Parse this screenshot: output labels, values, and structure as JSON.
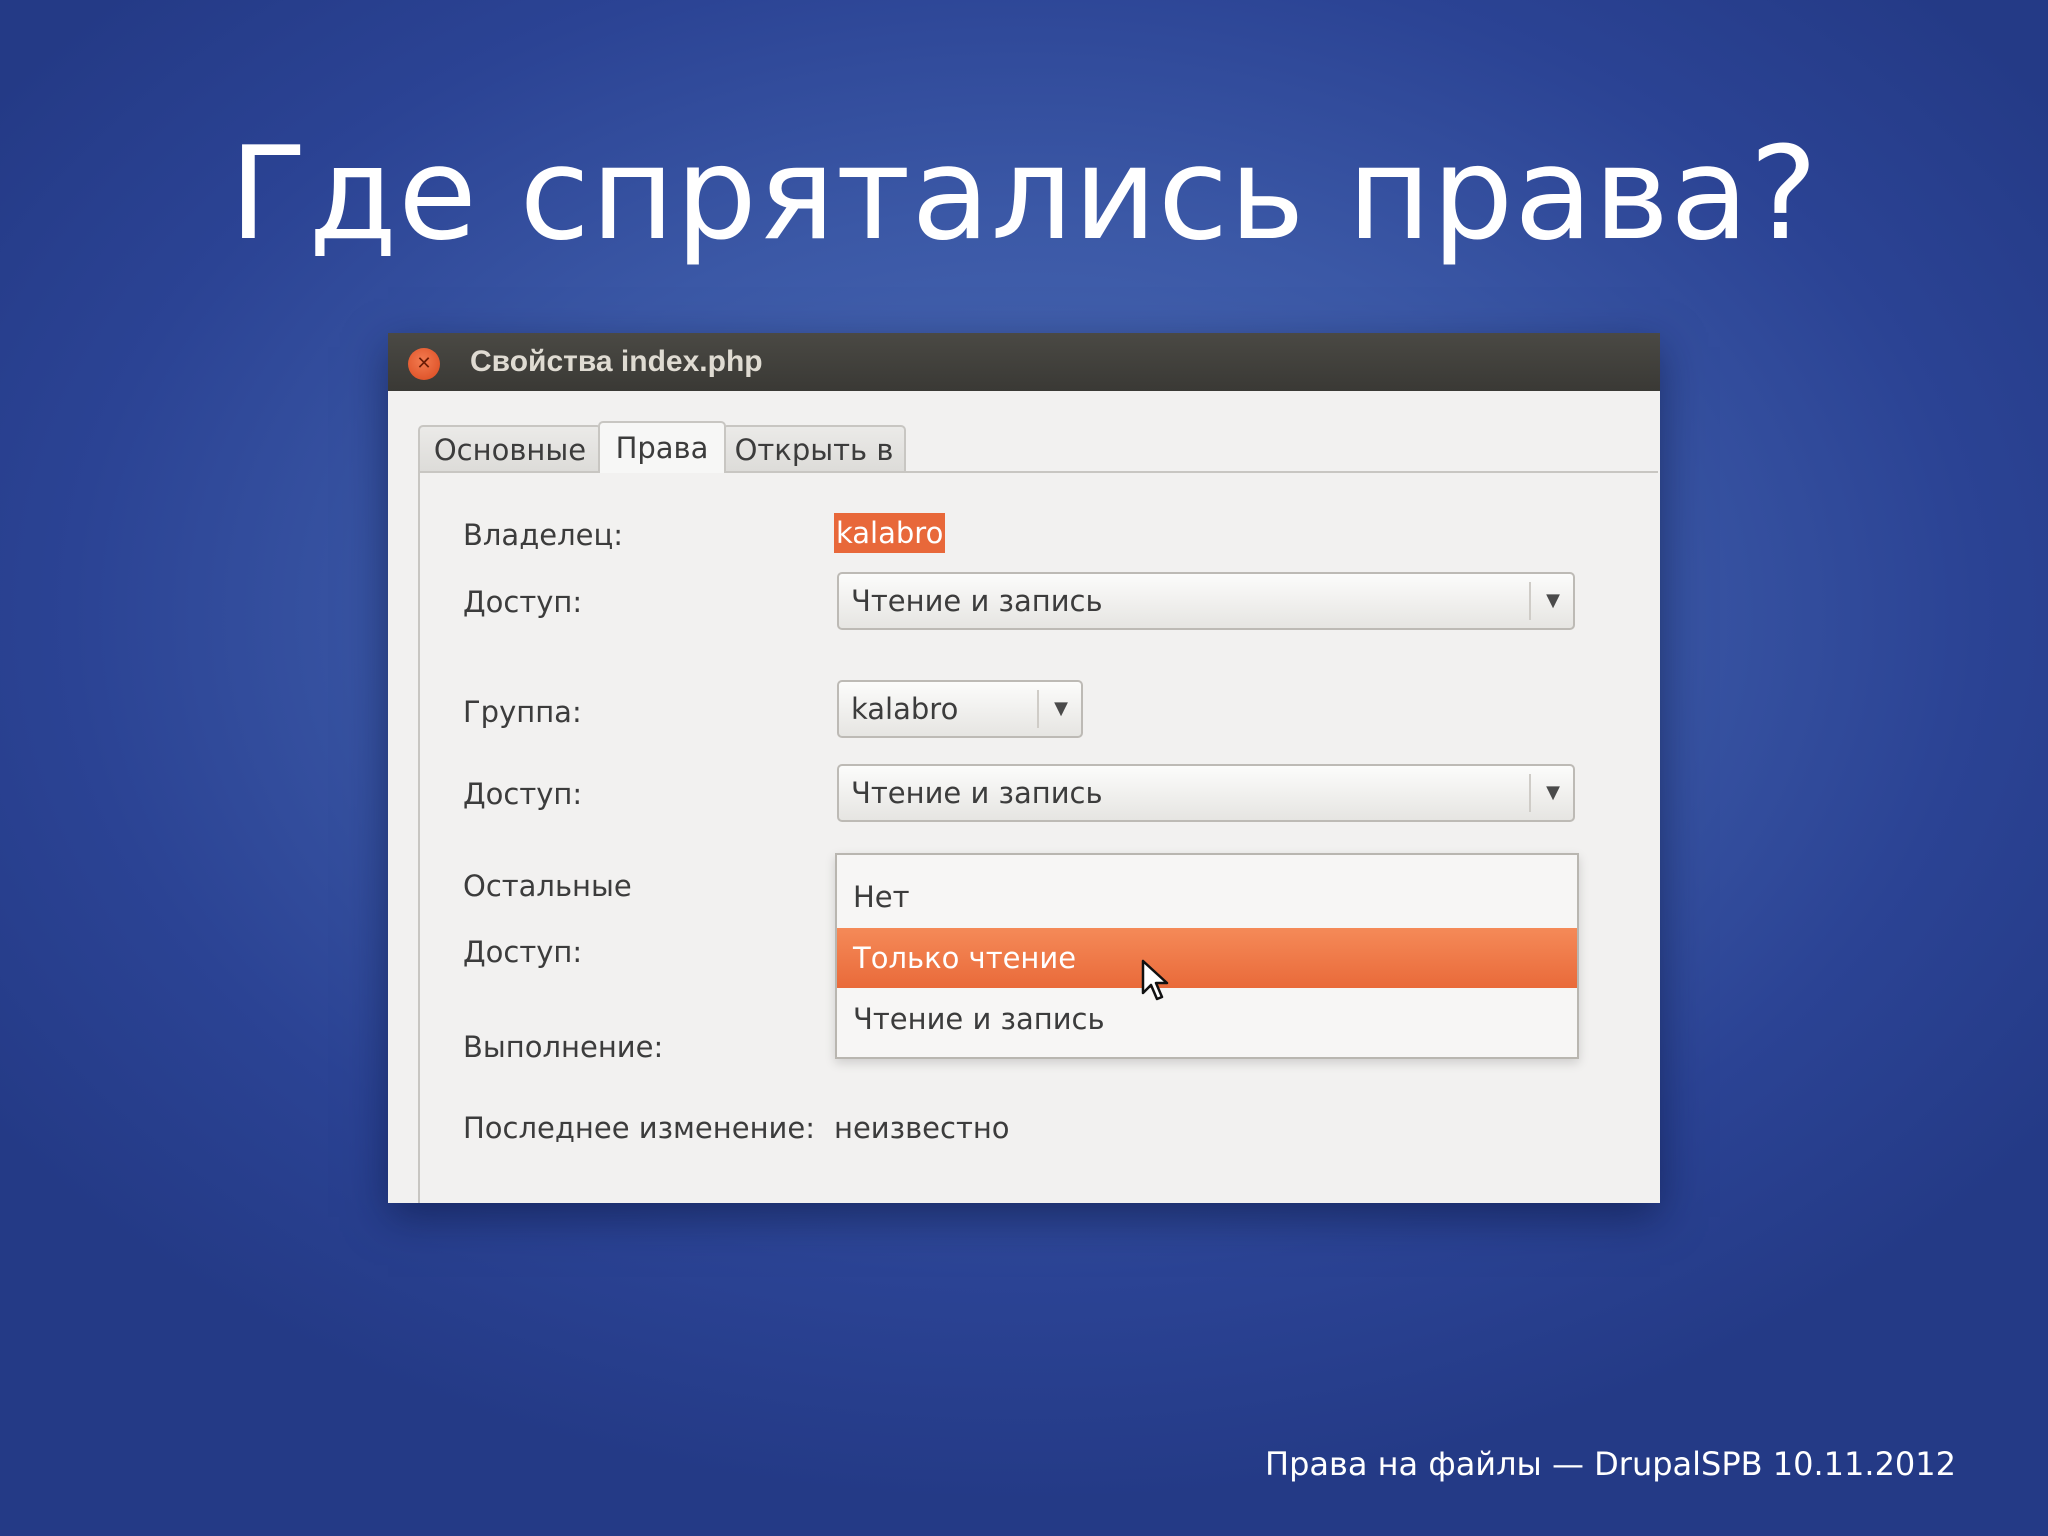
{
  "slide": {
    "title": "Где спрятались права?",
    "footer": "Права на файлы — DrupalSPB 10.11.2012"
  },
  "window": {
    "title": "Свойства index.php",
    "close_icon": "close-icon"
  },
  "tabs": [
    {
      "label": "Основные",
      "active": false
    },
    {
      "label": "Права",
      "active": true
    },
    {
      "label": "Открыть в",
      "active": false
    }
  ],
  "permissions": {
    "owner_label": "Владелец:",
    "owner_value": "kalabro",
    "owner_access_label": "Доступ:",
    "owner_access_value": "Чтение и запись",
    "group_label": "Группа:",
    "group_value": "kalabro",
    "group_access_label": "Доступ:",
    "group_access_value": "Чтение и запись",
    "others_label": "Остальные",
    "others_access_label": "Доступ:",
    "execute_label": "Выполнение:",
    "modified_label": "Последнее изменение:",
    "modified_value": "неизвестно"
  },
  "dropdown": {
    "options": [
      "Нет",
      "Только чтение",
      "Чтение и запись"
    ],
    "selected": "Только чтение"
  },
  "colors": {
    "accent": "#e96a3a",
    "background": "#3b58a6",
    "titlebar": "#3c3b37"
  }
}
